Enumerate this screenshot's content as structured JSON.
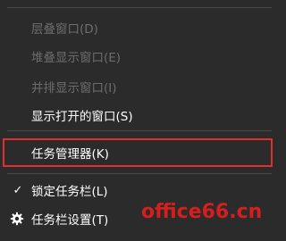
{
  "menu": {
    "items": [
      {
        "label": "层叠窗口(D)",
        "enabled": false
      },
      {
        "label": "堆叠显示窗口(E)",
        "enabled": false
      },
      {
        "label": "并排显示窗口(I)",
        "enabled": false
      },
      {
        "label": "显示打开的窗口(S)",
        "enabled": true
      },
      {
        "label": "任务管理器(K)",
        "enabled": true,
        "highlighted": true
      },
      {
        "label": "锁定任务栏(L)",
        "enabled": true,
        "checked": true
      },
      {
        "label": "任务栏设置(T)",
        "enabled": true,
        "icon": "gear-icon"
      }
    ]
  },
  "watermark": {
    "text": "office66.cn"
  },
  "colors": {
    "background": "#2b2b2b",
    "text": "#ffffff",
    "disabled_text": "#6d6d6d",
    "separator": "#474747",
    "highlight_border": "#e12e2e",
    "watermark": "#d51f1f"
  },
  "icons": {
    "check": "check-icon",
    "settings": "gear-icon"
  }
}
